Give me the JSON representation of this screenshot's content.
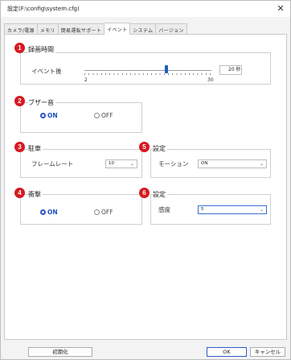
{
  "window": {
    "title": "設定(F:\\config\\system.cfg)",
    "close": "✕"
  },
  "tabs": [
    {
      "label": "カメラ/電源"
    },
    {
      "label": "メモリ"
    },
    {
      "label": "簡易運転サポート"
    },
    {
      "label": "イベント"
    },
    {
      "label": "システム"
    },
    {
      "label": "バージョン"
    }
  ],
  "active_tab": "イベント",
  "groups": {
    "recording": {
      "number": "1",
      "title": "録画時間",
      "label": "イベント後",
      "slider": {
        "min_label": "2",
        "max_label": "30",
        "min": 2,
        "max": 30,
        "value": 20
      },
      "value_text": "20 秒"
    },
    "buzzer": {
      "number": "2",
      "title": "ブザー音",
      "on_label": "ON",
      "off_label": "OFF",
      "selected": "ON"
    },
    "parking": {
      "number": "3",
      "title": "駐車",
      "label": "フレームレート",
      "value": "10"
    },
    "impact": {
      "number": "4",
      "title": "衝撃",
      "on_label": "ON",
      "off_label": "OFF",
      "selected": "ON"
    },
    "setting5": {
      "number": "5",
      "title": "設定",
      "label": "モーション",
      "value": "ON"
    },
    "setting6": {
      "number": "6",
      "title": "設定",
      "label": "感度",
      "value": "5"
    }
  },
  "footer": {
    "reset": "初期化",
    "ok": "OK",
    "cancel": "キャンセル"
  },
  "colors": {
    "badge": "#d71920",
    "radio_selected": "#2a55c8",
    "accent": "#1f5fbf"
  }
}
